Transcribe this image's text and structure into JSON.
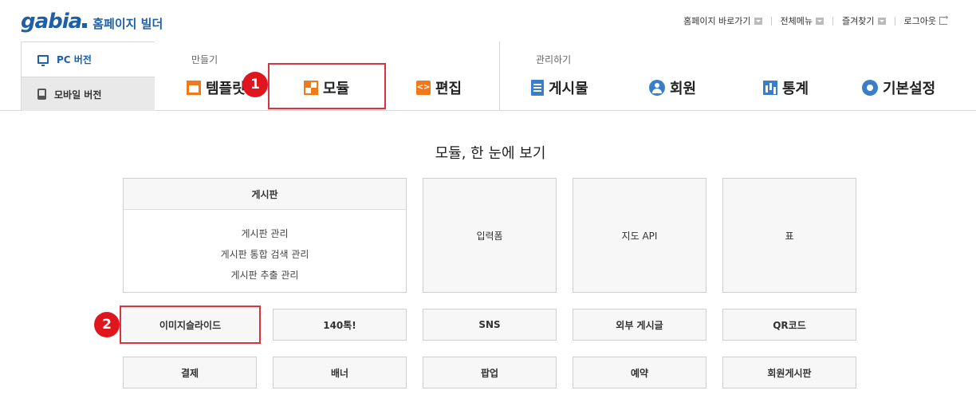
{
  "header": {
    "logo_text": "gabia",
    "logo_subtitle": "홈페이지 빌더",
    "links": {
      "homepage": "홈페이지 바로가기",
      "all_menu": "전체메뉴",
      "favorites": "즐겨찾기",
      "logout": "로그아웃"
    }
  },
  "version_tabs": {
    "pc": "PC 버전",
    "mobile": "모바일 버전"
  },
  "nav": {
    "make_label": "만들기",
    "manage_label": "관리하기",
    "template": "템플릿",
    "module": "모듈",
    "edit": "편집",
    "edit_icon": "<>",
    "posts": "게시물",
    "members": "회원",
    "stats": "통계",
    "settings": "기본설정"
  },
  "annotations": {
    "badge1": "1",
    "badge2": "2"
  },
  "main": {
    "title": "모듈, 한 눈에 보기",
    "board_card": {
      "title": "게시판",
      "links": [
        "게시판 관리",
        "게시판 통합 검색 관리",
        "게시판 추출 관리"
      ]
    },
    "cards": {
      "input_form": "입력폼",
      "map_api": "지도 API",
      "table": "표"
    },
    "row1": [
      "이미지슬라이드",
      "140톡!",
      "SNS",
      "외부 게시글",
      "QR코드"
    ],
    "row2": [
      "결제",
      "배너",
      "팝업",
      "예약",
      "회원게시판"
    ]
  }
}
